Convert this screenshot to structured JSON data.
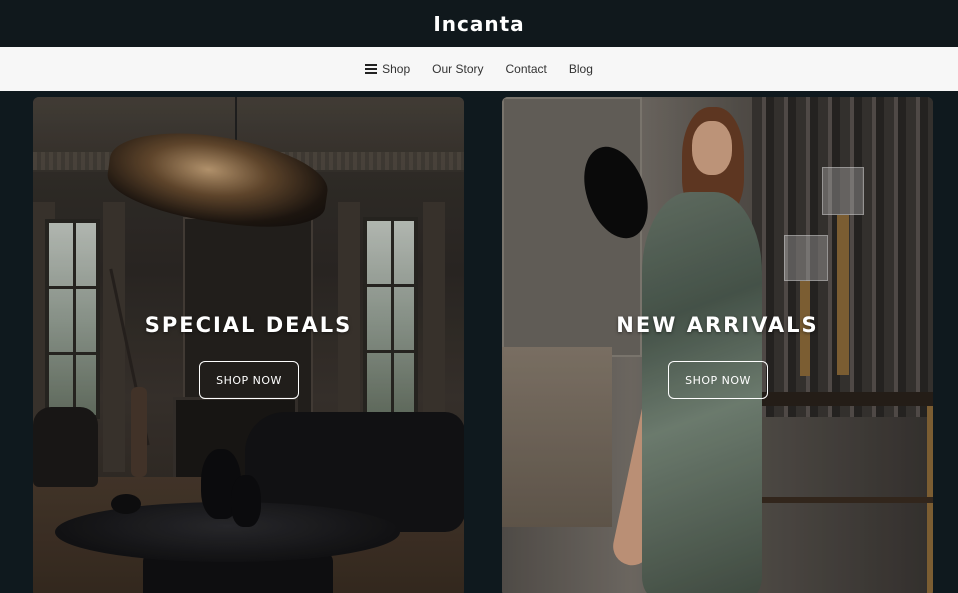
{
  "header": {
    "brand": "Incanta"
  },
  "nav": {
    "items": [
      {
        "label": "Shop",
        "icon": "hamburger-menu-icon"
      },
      {
        "label": "Our Story"
      },
      {
        "label": "Contact"
      },
      {
        "label": "Blog"
      }
    ]
  },
  "promos": [
    {
      "title": "SPECIAL DEALS",
      "button": "SHOP NOW"
    },
    {
      "title": "NEW ARRIVALS",
      "button": "SHOP NOW"
    }
  ],
  "colors": {
    "header_bg": "#10181c",
    "nav_bg": "#f7f7f7",
    "page_bg": "#0f191e",
    "text_light": "#ffffff"
  }
}
